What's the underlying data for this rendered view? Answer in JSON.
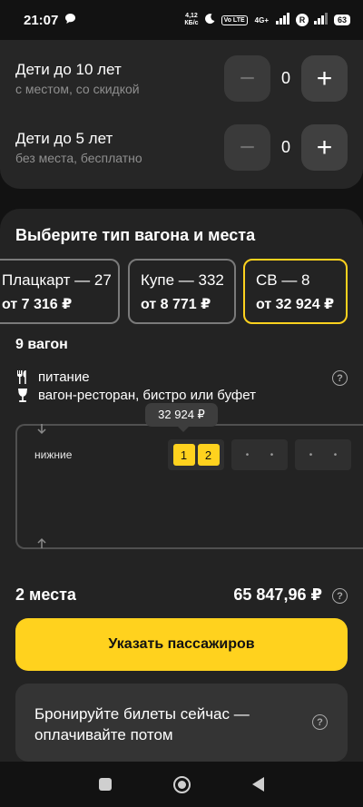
{
  "status_bar": {
    "time": "21:07",
    "net_speed_value": "4,12",
    "net_speed_unit": "КБ/с",
    "volte_label": "Vo LTE",
    "network_label": "4G+",
    "r_label": "R",
    "battery": "63"
  },
  "passengers": [
    {
      "title": "Дети до 10 лет",
      "subtitle": "с местом, со скидкой",
      "count": "0",
      "minus": "−",
      "plus": "+"
    },
    {
      "title": "Дети до 5 лет",
      "subtitle": "без места, бесплатно",
      "count": "0",
      "minus": "−",
      "plus": "+"
    }
  ],
  "section_title": "Выберите тип вагона и места",
  "car_types": [
    {
      "name": "Плацкарт — 27",
      "price": "от 7 316 ₽"
    },
    {
      "name": "Купе — 332",
      "price": "от 8 771 ₽"
    },
    {
      "name": "СВ — 8",
      "price": "от 32 924 ₽"
    }
  ],
  "wagon": {
    "title": "9 вагон",
    "amenity_food": "питание",
    "amenity_restaurant": "вагон-ресторан, бистро или буфет",
    "help_glyph": "?",
    "tooltip_price": "32 924 ₽",
    "row_label": "нижние",
    "seat_1": "1",
    "seat_2": "2",
    "dot": "•"
  },
  "summary": {
    "count_label": "2 места",
    "total_price": "65 847,96 ₽"
  },
  "cta_label": "Указать пассажиров",
  "promo_text": "Бронируйте билеты сейчас — оплачивайте потом",
  "colors": {
    "accent": "#ffd21e",
    "background": "#121212",
    "card": "#262626"
  }
}
